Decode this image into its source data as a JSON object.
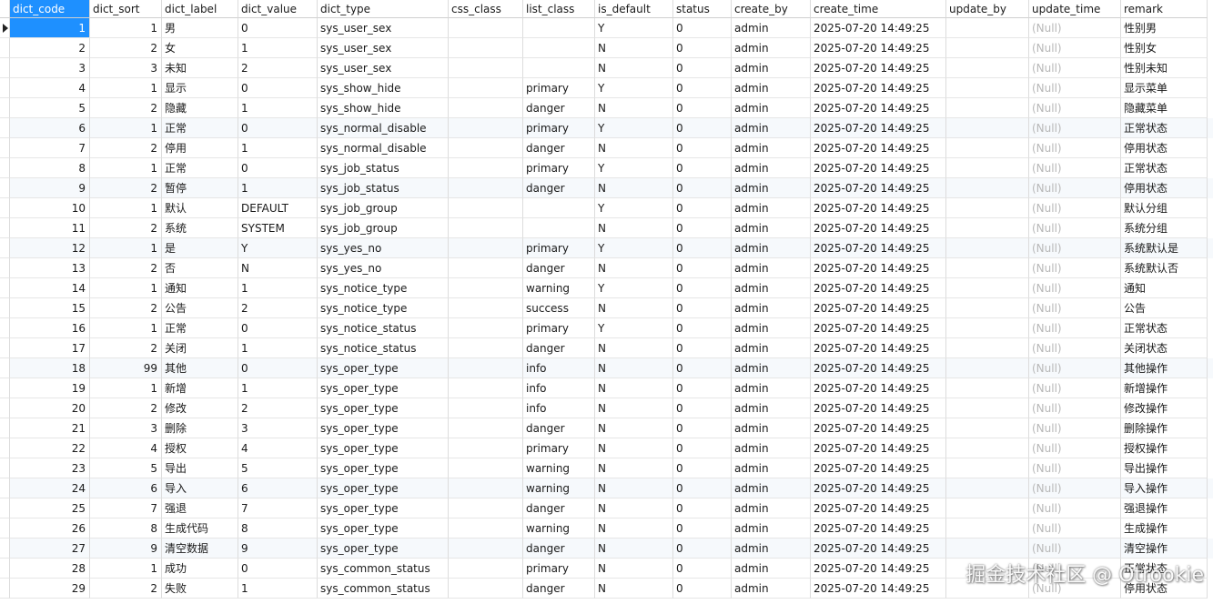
{
  "columns": [
    "dict_code",
    "dict_sort",
    "dict_label",
    "dict_value",
    "dict_type",
    "css_class",
    "list_class",
    "is_default",
    "status",
    "create_by",
    "create_time",
    "update_by",
    "update_time",
    "remark"
  ],
  "selected": {
    "row": 0,
    "column": "dict_code"
  },
  "null_text": "(Null)",
  "rows": [
    {
      "dict_code": "1",
      "dict_sort": "1",
      "dict_label": "男",
      "dict_value": "0",
      "dict_type": "sys_user_sex",
      "css_class": "",
      "list_class": "",
      "is_default": "Y",
      "status": "0",
      "create_by": "admin",
      "create_time": "2025-07-20 14:49:25",
      "update_by": "",
      "update_time": "(Null)",
      "remark": "性别男"
    },
    {
      "dict_code": "2",
      "dict_sort": "2",
      "dict_label": "女",
      "dict_value": "1",
      "dict_type": "sys_user_sex",
      "css_class": "",
      "list_class": "",
      "is_default": "N",
      "status": "0",
      "create_by": "admin",
      "create_time": "2025-07-20 14:49:25",
      "update_by": "",
      "update_time": "(Null)",
      "remark": "性别女"
    },
    {
      "dict_code": "3",
      "dict_sort": "3",
      "dict_label": "未知",
      "dict_value": "2",
      "dict_type": "sys_user_sex",
      "css_class": "",
      "list_class": "",
      "is_default": "N",
      "status": "0",
      "create_by": "admin",
      "create_time": "2025-07-20 14:49:25",
      "update_by": "",
      "update_time": "(Null)",
      "remark": "性别未知"
    },
    {
      "dict_code": "4",
      "dict_sort": "1",
      "dict_label": "显示",
      "dict_value": "0",
      "dict_type": "sys_show_hide",
      "css_class": "",
      "list_class": "primary",
      "is_default": "Y",
      "status": "0",
      "create_by": "admin",
      "create_time": "2025-07-20 14:49:25",
      "update_by": "",
      "update_time": "(Null)",
      "remark": "显示菜单"
    },
    {
      "dict_code": "5",
      "dict_sort": "2",
      "dict_label": "隐藏",
      "dict_value": "1",
      "dict_type": "sys_show_hide",
      "css_class": "",
      "list_class": "danger",
      "is_default": "N",
      "status": "0",
      "create_by": "admin",
      "create_time": "2025-07-20 14:49:25",
      "update_by": "",
      "update_time": "(Null)",
      "remark": "隐藏菜单"
    },
    {
      "dict_code": "6",
      "dict_sort": "1",
      "dict_label": "正常",
      "dict_value": "0",
      "dict_type": "sys_normal_disable",
      "css_class": "",
      "list_class": "primary",
      "is_default": "Y",
      "status": "0",
      "create_by": "admin",
      "create_time": "2025-07-20 14:49:25",
      "update_by": "",
      "update_time": "(Null)",
      "remark": "正常状态"
    },
    {
      "dict_code": "7",
      "dict_sort": "2",
      "dict_label": "停用",
      "dict_value": "1",
      "dict_type": "sys_normal_disable",
      "css_class": "",
      "list_class": "danger",
      "is_default": "N",
      "status": "0",
      "create_by": "admin",
      "create_time": "2025-07-20 14:49:25",
      "update_by": "",
      "update_time": "(Null)",
      "remark": "停用状态"
    },
    {
      "dict_code": "8",
      "dict_sort": "1",
      "dict_label": "正常",
      "dict_value": "0",
      "dict_type": "sys_job_status",
      "css_class": "",
      "list_class": "primary",
      "is_default": "Y",
      "status": "0",
      "create_by": "admin",
      "create_time": "2025-07-20 14:49:25",
      "update_by": "",
      "update_time": "(Null)",
      "remark": "正常状态"
    },
    {
      "dict_code": "9",
      "dict_sort": "2",
      "dict_label": "暂停",
      "dict_value": "1",
      "dict_type": "sys_job_status",
      "css_class": "",
      "list_class": "danger",
      "is_default": "N",
      "status": "0",
      "create_by": "admin",
      "create_time": "2025-07-20 14:49:25",
      "update_by": "",
      "update_time": "(Null)",
      "remark": "停用状态"
    },
    {
      "dict_code": "10",
      "dict_sort": "1",
      "dict_label": "默认",
      "dict_value": "DEFAULT",
      "dict_type": "sys_job_group",
      "css_class": "",
      "list_class": "",
      "is_default": "Y",
      "status": "0",
      "create_by": "admin",
      "create_time": "2025-07-20 14:49:25",
      "update_by": "",
      "update_time": "(Null)",
      "remark": "默认分组"
    },
    {
      "dict_code": "11",
      "dict_sort": "2",
      "dict_label": "系统",
      "dict_value": "SYSTEM",
      "dict_type": "sys_job_group",
      "css_class": "",
      "list_class": "",
      "is_default": "N",
      "status": "0",
      "create_by": "admin",
      "create_time": "2025-07-20 14:49:25",
      "update_by": "",
      "update_time": "(Null)",
      "remark": "系统分组"
    },
    {
      "dict_code": "12",
      "dict_sort": "1",
      "dict_label": "是",
      "dict_value": "Y",
      "dict_type": "sys_yes_no",
      "css_class": "",
      "list_class": "primary",
      "is_default": "Y",
      "status": "0",
      "create_by": "admin",
      "create_time": "2025-07-20 14:49:25",
      "update_by": "",
      "update_time": "(Null)",
      "remark": "系统默认是"
    },
    {
      "dict_code": "13",
      "dict_sort": "2",
      "dict_label": "否",
      "dict_value": "N",
      "dict_type": "sys_yes_no",
      "css_class": "",
      "list_class": "danger",
      "is_default": "N",
      "status": "0",
      "create_by": "admin",
      "create_time": "2025-07-20 14:49:25",
      "update_by": "",
      "update_time": "(Null)",
      "remark": "系统默认否"
    },
    {
      "dict_code": "14",
      "dict_sort": "1",
      "dict_label": "通知",
      "dict_value": "1",
      "dict_type": "sys_notice_type",
      "css_class": "",
      "list_class": "warning",
      "is_default": "Y",
      "status": "0",
      "create_by": "admin",
      "create_time": "2025-07-20 14:49:25",
      "update_by": "",
      "update_time": "(Null)",
      "remark": "通知"
    },
    {
      "dict_code": "15",
      "dict_sort": "2",
      "dict_label": "公告",
      "dict_value": "2",
      "dict_type": "sys_notice_type",
      "css_class": "",
      "list_class": "success",
      "is_default": "N",
      "status": "0",
      "create_by": "admin",
      "create_time": "2025-07-20 14:49:25",
      "update_by": "",
      "update_time": "(Null)",
      "remark": "公告"
    },
    {
      "dict_code": "16",
      "dict_sort": "1",
      "dict_label": "正常",
      "dict_value": "0",
      "dict_type": "sys_notice_status",
      "css_class": "",
      "list_class": "primary",
      "is_default": "Y",
      "status": "0",
      "create_by": "admin",
      "create_time": "2025-07-20 14:49:25",
      "update_by": "",
      "update_time": "(Null)",
      "remark": "正常状态"
    },
    {
      "dict_code": "17",
      "dict_sort": "2",
      "dict_label": "关闭",
      "dict_value": "1",
      "dict_type": "sys_notice_status",
      "css_class": "",
      "list_class": "danger",
      "is_default": "N",
      "status": "0",
      "create_by": "admin",
      "create_time": "2025-07-20 14:49:25",
      "update_by": "",
      "update_time": "(Null)",
      "remark": "关闭状态"
    },
    {
      "dict_code": "18",
      "dict_sort": "99",
      "dict_label": "其他",
      "dict_value": "0",
      "dict_type": "sys_oper_type",
      "css_class": "",
      "list_class": "info",
      "is_default": "N",
      "status": "0",
      "create_by": "admin",
      "create_time": "2025-07-20 14:49:25",
      "update_by": "",
      "update_time": "(Null)",
      "remark": "其他操作"
    },
    {
      "dict_code": "19",
      "dict_sort": "1",
      "dict_label": "新增",
      "dict_value": "1",
      "dict_type": "sys_oper_type",
      "css_class": "",
      "list_class": "info",
      "is_default": "N",
      "status": "0",
      "create_by": "admin",
      "create_time": "2025-07-20 14:49:25",
      "update_by": "",
      "update_time": "(Null)",
      "remark": "新增操作"
    },
    {
      "dict_code": "20",
      "dict_sort": "2",
      "dict_label": "修改",
      "dict_value": "2",
      "dict_type": "sys_oper_type",
      "css_class": "",
      "list_class": "info",
      "is_default": "N",
      "status": "0",
      "create_by": "admin",
      "create_time": "2025-07-20 14:49:25",
      "update_by": "",
      "update_time": "(Null)",
      "remark": "修改操作"
    },
    {
      "dict_code": "21",
      "dict_sort": "3",
      "dict_label": "删除",
      "dict_value": "3",
      "dict_type": "sys_oper_type",
      "css_class": "",
      "list_class": "danger",
      "is_default": "N",
      "status": "0",
      "create_by": "admin",
      "create_time": "2025-07-20 14:49:25",
      "update_by": "",
      "update_time": "(Null)",
      "remark": "删除操作"
    },
    {
      "dict_code": "22",
      "dict_sort": "4",
      "dict_label": "授权",
      "dict_value": "4",
      "dict_type": "sys_oper_type",
      "css_class": "",
      "list_class": "primary",
      "is_default": "N",
      "status": "0",
      "create_by": "admin",
      "create_time": "2025-07-20 14:49:25",
      "update_by": "",
      "update_time": "(Null)",
      "remark": "授权操作"
    },
    {
      "dict_code": "23",
      "dict_sort": "5",
      "dict_label": "导出",
      "dict_value": "5",
      "dict_type": "sys_oper_type",
      "css_class": "",
      "list_class": "warning",
      "is_default": "N",
      "status": "0",
      "create_by": "admin",
      "create_time": "2025-07-20 14:49:25",
      "update_by": "",
      "update_time": "(Null)",
      "remark": "导出操作"
    },
    {
      "dict_code": "24",
      "dict_sort": "6",
      "dict_label": "导入",
      "dict_value": "6",
      "dict_type": "sys_oper_type",
      "css_class": "",
      "list_class": "warning",
      "is_default": "N",
      "status": "0",
      "create_by": "admin",
      "create_time": "2025-07-20 14:49:25",
      "update_by": "",
      "update_time": "(Null)",
      "remark": "导入操作"
    },
    {
      "dict_code": "25",
      "dict_sort": "7",
      "dict_label": "强退",
      "dict_value": "7",
      "dict_type": "sys_oper_type",
      "css_class": "",
      "list_class": "danger",
      "is_default": "N",
      "status": "0",
      "create_by": "admin",
      "create_time": "2025-07-20 14:49:25",
      "update_by": "",
      "update_time": "(Null)",
      "remark": "强退操作"
    },
    {
      "dict_code": "26",
      "dict_sort": "8",
      "dict_label": "生成代码",
      "dict_value": "8",
      "dict_type": "sys_oper_type",
      "css_class": "",
      "list_class": "warning",
      "is_default": "N",
      "status": "0",
      "create_by": "admin",
      "create_time": "2025-07-20 14:49:25",
      "update_by": "",
      "update_time": "(Null)",
      "remark": "生成操作"
    },
    {
      "dict_code": "27",
      "dict_sort": "9",
      "dict_label": "清空数据",
      "dict_value": "9",
      "dict_type": "sys_oper_type",
      "css_class": "",
      "list_class": "danger",
      "is_default": "N",
      "status": "0",
      "create_by": "admin",
      "create_time": "2025-07-20 14:49:25",
      "update_by": "",
      "update_time": "(Null)",
      "remark": "清空操作"
    },
    {
      "dict_code": "28",
      "dict_sort": "1",
      "dict_label": "成功",
      "dict_value": "0",
      "dict_type": "sys_common_status",
      "css_class": "",
      "list_class": "primary",
      "is_default": "N",
      "status": "0",
      "create_by": "admin",
      "create_time": "2025-07-20 14:49:25",
      "update_by": "",
      "update_time": "(Null)",
      "remark": "正常状态"
    },
    {
      "dict_code": "29",
      "dict_sort": "2",
      "dict_label": "失败",
      "dict_value": "1",
      "dict_type": "sys_common_status",
      "css_class": "",
      "list_class": "danger",
      "is_default": "N",
      "status": "0",
      "create_by": "admin",
      "create_time": "2025-07-20 14:49:25",
      "update_by": "",
      "update_time": "(Null)",
      "remark": "停用状态"
    }
  ],
  "watermark": "掘金技术社区 @ Otrookie",
  "colors": {
    "selection": "#1e90ff",
    "null_text": "#b8b8b8",
    "alt_row": "#f6f9fc"
  }
}
